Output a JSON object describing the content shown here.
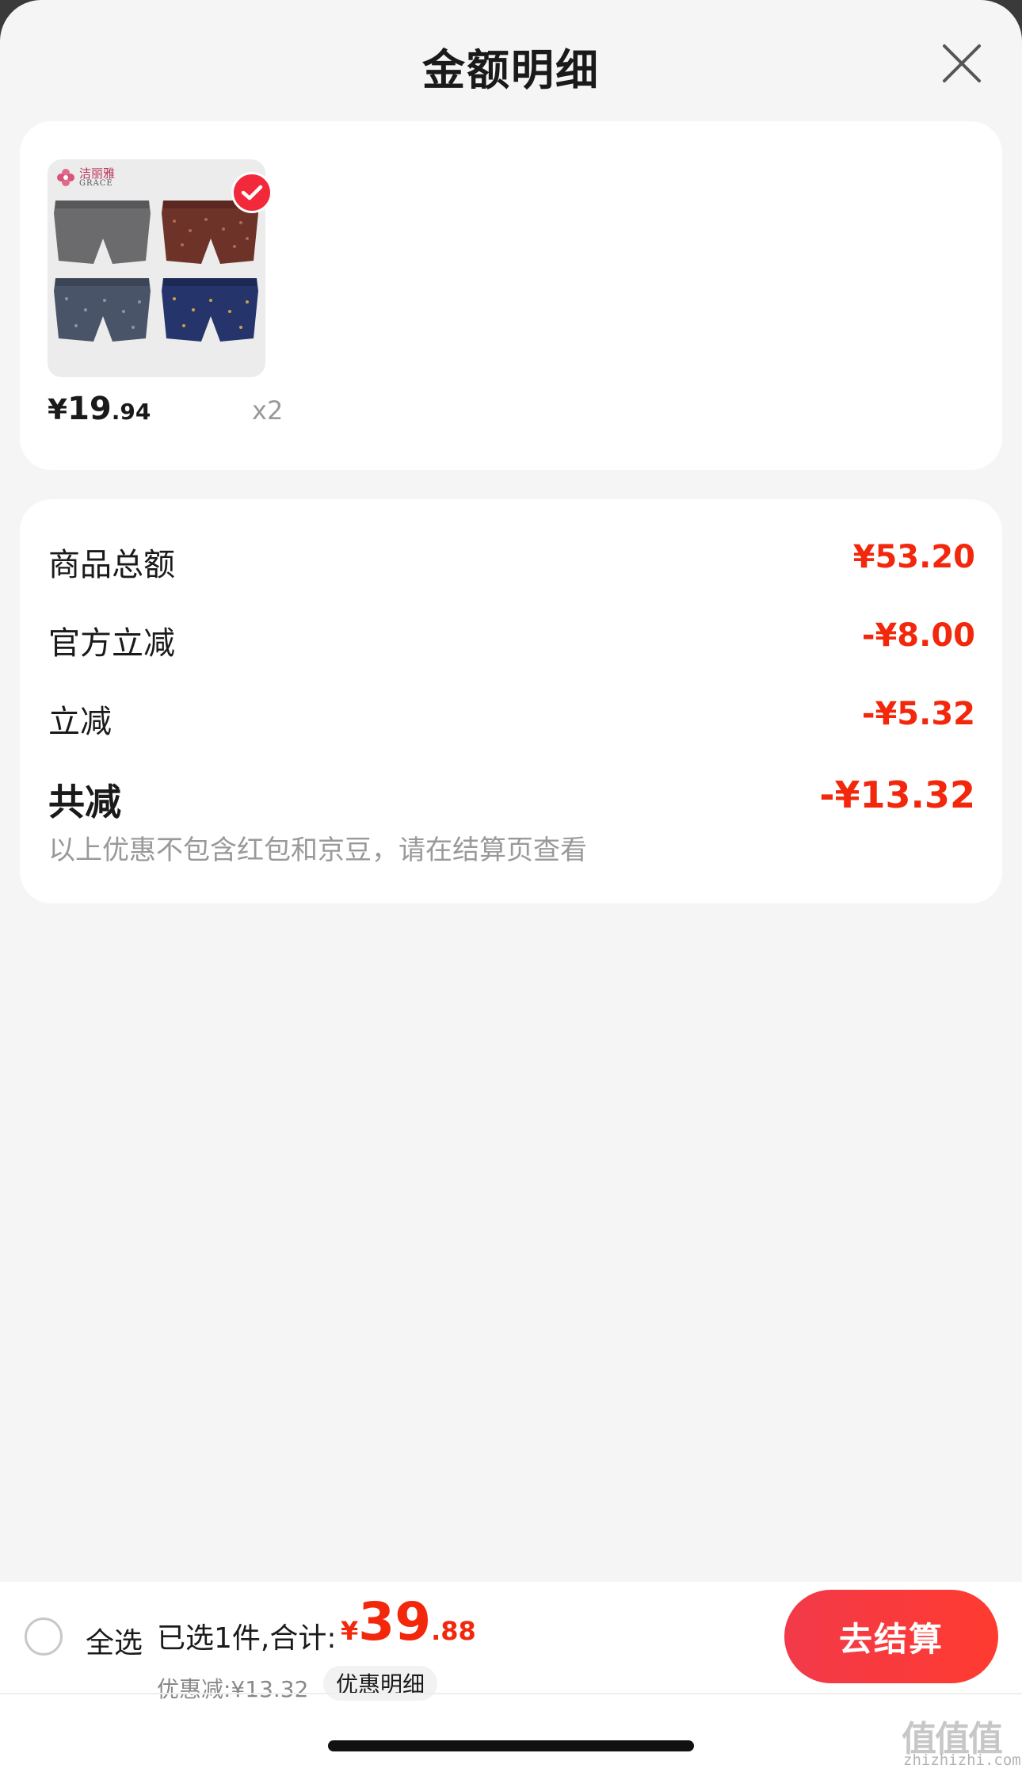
{
  "header": {
    "title": "金额明细",
    "close_icon": "close-icon"
  },
  "product": {
    "brand_cn": "洁丽雅",
    "brand_en": "GRACE",
    "selected": true,
    "price_symbol": "¥",
    "price_int": "19",
    "price_dec": ".94",
    "quantity": "x2"
  },
  "summary": {
    "rows": [
      {
        "label": "商品总额",
        "value": "¥53.20"
      },
      {
        "label": "官方立减",
        "value": "-¥8.00"
      },
      {
        "label": "立减",
        "value": "-¥5.32"
      }
    ],
    "total": {
      "label": "共减",
      "value": "-¥13.32"
    },
    "note": "以上优惠不包含红包和京豆，请在结算页查看"
  },
  "bottom_bar": {
    "select_all": "全选",
    "selected_text": "已选1件,合计:",
    "total_symbol": "¥",
    "total_int": "39",
    "total_dec": ".88",
    "discount": "优惠减:¥13.32",
    "detail_link": "优惠明细",
    "checkout": "去结算"
  },
  "watermark": {
    "main": "值值值",
    "sub": "zhizhizhi.com"
  },
  "colors": {
    "accent": "#f2270c",
    "button": "#f23a4a",
    "background": "#f5f5f5",
    "card": "#ffffff"
  }
}
